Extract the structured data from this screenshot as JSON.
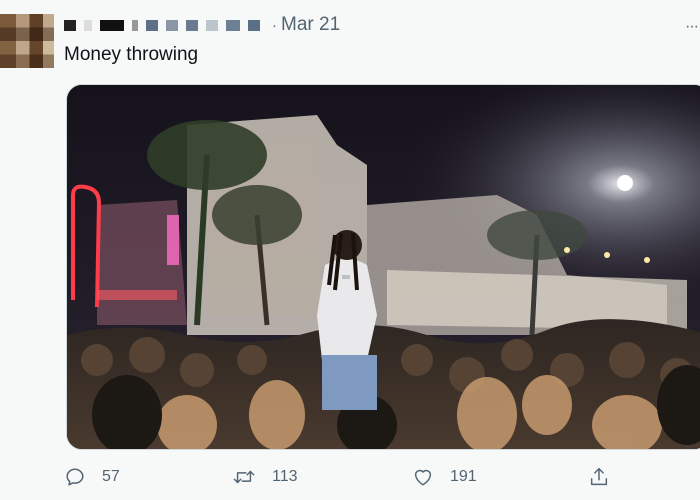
{
  "tweet": {
    "date": "Mar 21",
    "separator": "·",
    "text": "Money throwing",
    "more_icon": "more-icon",
    "media_alt": "video"
  },
  "actions": {
    "reply_count": "57",
    "retweet_count": "113",
    "like_count": "191"
  },
  "colors": {
    "secondary_text": "#536471",
    "background": "#f7f9f9",
    "media_border": "#cfd9de"
  }
}
